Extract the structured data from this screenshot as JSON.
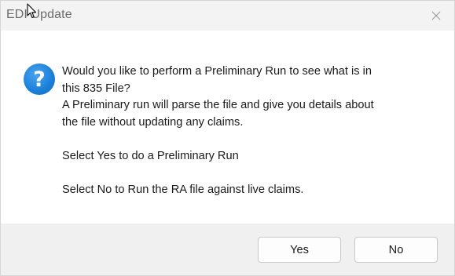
{
  "window": {
    "title": "EDI Update"
  },
  "icons": {
    "question": "question-icon",
    "close": "close-icon",
    "cursor": "mouse-cursor-icon"
  },
  "message": {
    "lines": [
      "Would you like to perform a Preliminary Run to see what is in",
      "this 835 File?",
      "A Preliminary run will parse the file and give you details about",
      "the file without updating any claims.",
      "",
      "Select Yes to do a Preliminary Run",
      "",
      "Select No to Run the RA file against live claims."
    ],
    "icon_glyph": "?"
  },
  "buttons": {
    "yes_label": "Yes",
    "no_label": "No"
  },
  "colors": {
    "accent": "#1a7fd8",
    "titlebar_bg": "#f3f3f3",
    "footer_bg": "#f0f0f0"
  }
}
